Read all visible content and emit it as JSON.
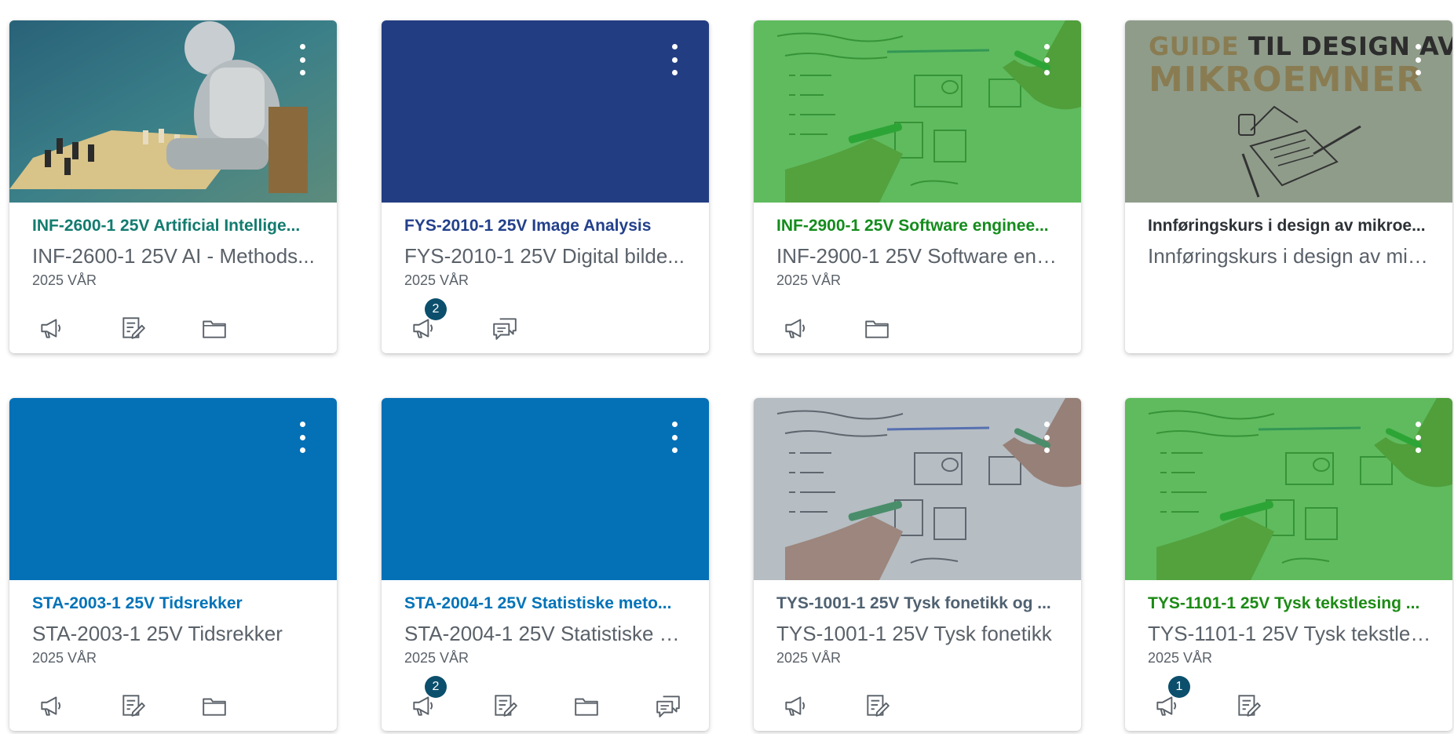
{
  "colors": {
    "ai_title": "#127b6f",
    "navy": "#23408b",
    "green": "#138c1c",
    "dark": "#2c3136",
    "blue": "#0073b8",
    "slate": "#4f6171",
    "green2": "#1c8b14",
    "badge": "#0b4f6c"
  },
  "cards": [
    {
      "title": "INF-2600-1 25V Artificial Intellige...",
      "subtitle": "INF-2600-1 25V AI - Methods...",
      "term": "2025 VÅR"
    },
    {
      "title": "FYS-2010-1 25V Image Analysis",
      "subtitle": "FYS-2010-1 25V Digital bilde...",
      "term": "2025 VÅR",
      "badge": "2"
    },
    {
      "title": "INF-2900-1 25V Software enginee...",
      "subtitle": "INF-2900-1 25V Software eng...",
      "term": "2025 VÅR"
    },
    {
      "title": "Innføringskurs i design av mikroe...",
      "subtitle": "Innføringskurs i design av mikr...",
      "term": "",
      "hero_text_1a": "GUIDE",
      "hero_text_1b": " TIL DESIGN AV",
      "hero_text_2": "MIKROEMNER"
    },
    {
      "title": "STA-2003-1 25V Tidsrekker",
      "subtitle": "STA-2003-1 25V Tidsrekker",
      "term": "2025 VÅR"
    },
    {
      "title": "STA-2004-1 25V Statistiske meto...",
      "subtitle": "STA-2004-1 25V Statistiske m...",
      "term": "2025 VÅR",
      "badge": "2"
    },
    {
      "title": "TYS-1001-1 25V Tysk fonetikk og ...",
      "subtitle": "TYS-1001-1 25V Tysk fonetikk",
      "term": "2025 VÅR"
    },
    {
      "title": "TYS-1101-1 25V Tysk tekstlesing ...",
      "subtitle": "TYS-1101-1 25V Tysk tekstles...",
      "term": "2025 VÅR",
      "badge": "1"
    }
  ],
  "icons": [
    "announcement-icon",
    "assignment-icon",
    "folder-icon",
    "discussion-icon",
    "kebab-menu-icon"
  ]
}
